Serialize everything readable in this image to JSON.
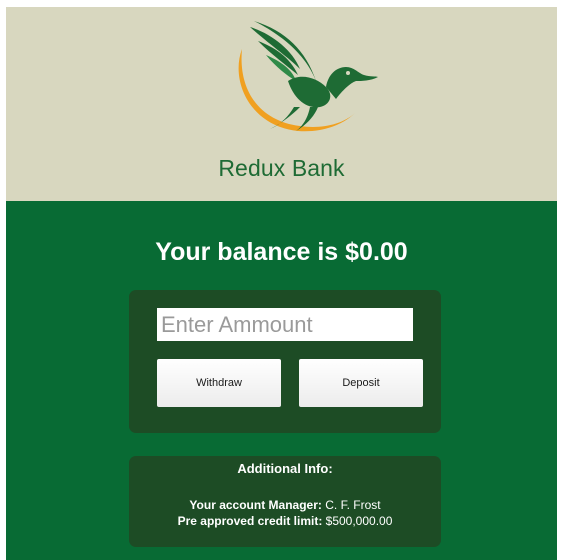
{
  "header": {
    "bank_name": "Redux Bank"
  },
  "account": {
    "balance_text": "Your balance is $0.00"
  },
  "form": {
    "amount_placeholder": "Enter Ammount",
    "amount_value": "",
    "withdraw_label": "Withdraw",
    "deposit_label": "Deposit"
  },
  "info": {
    "title": "Additional Info:",
    "manager_label": "Your account Manager:",
    "manager_value": "C. F. Frost",
    "credit_label": "Pre approved credit limit:",
    "credit_value": "$500,000.00"
  },
  "colors": {
    "header_bg": "#d8d7bf",
    "main_bg": "#086b34",
    "panel_bg": "#1d4c25",
    "brand_text": "#1e6b34",
    "logo_arc": "#f0a020"
  },
  "icons": {
    "logo": "flying-duck-logo-icon"
  }
}
